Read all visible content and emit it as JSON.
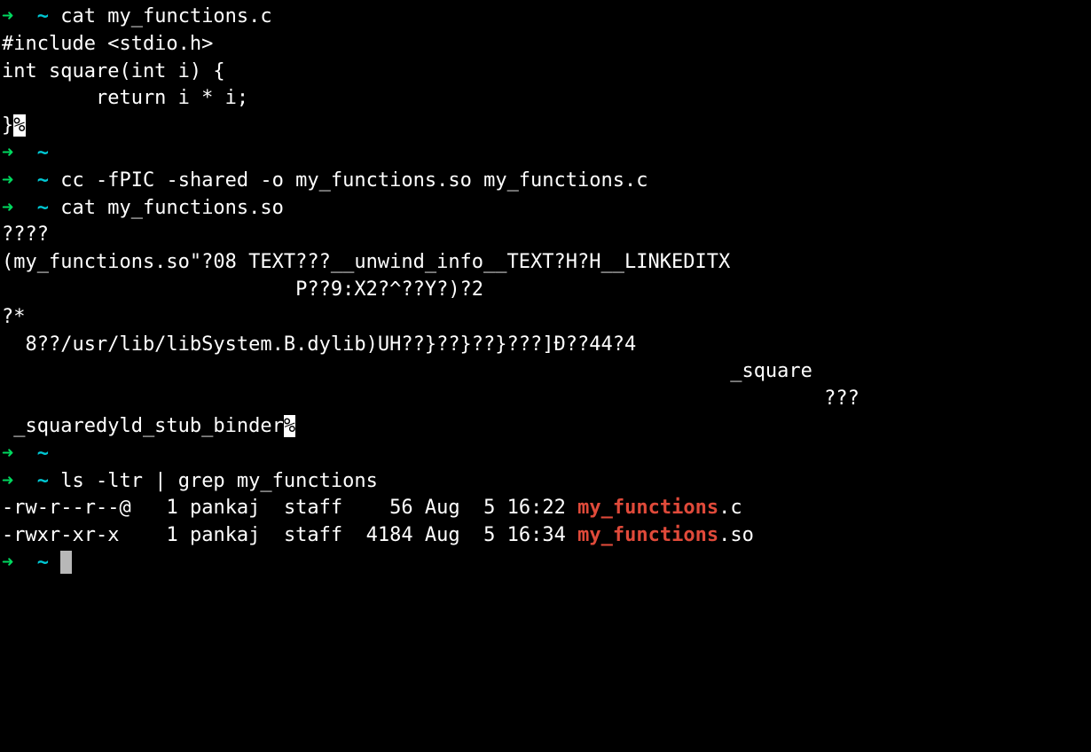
{
  "prompt": {
    "arrow": "➜",
    "tilde": "~"
  },
  "commands": {
    "cat_c": "cat my_functions.c",
    "empty": "",
    "cc": "cc -fPIC -shared -o my_functions.so my_functions.c",
    "cat_so": "cat my_functions.so",
    "ls_grep": "ls -ltr | grep my_functions"
  },
  "c_source": {
    "line1": "#include <stdio.h>",
    "line2": "",
    "line3": "int square(int i) {",
    "line4": "        return i * i;",
    "line5_a": "}",
    "line5_b": "%"
  },
  "so_binary": {
    "line1": "????",
    "line2": "(my_functions.so\"?08 TEXT???__unwind_info__TEXT?H?H__LINKEDITX",
    "line3": "                         P??9:X2?^??Y?)?2",
    "line4": "",
    "line5": "?*",
    "line6": "  8??/usr/lib/libSystem.B.dylib)UH??}??}??}???]Ð??44?4",
    "line7": "                                                              _square",
    "line8": "                                                                      ???",
    "line9_a": " _squaredyld_stub_binder",
    "line9_b": "%"
  },
  "ls_output": {
    "row1": {
      "perms": "-rw-r--r--@",
      "links": "1",
      "user": "pankaj",
      "group": "staff",
      "size": "56",
      "month": "Aug",
      "day": "5",
      "time": "16:22",
      "name_match": "my_functions",
      "name_ext": ".c"
    },
    "row2": {
      "perms": "-rwxr-xr-x ",
      "links": "1",
      "user": "pankaj",
      "group": "staff",
      "size": "4184",
      "month": "Aug",
      "day": "5",
      "time": "16:34",
      "name_match": "my_functions",
      "name_ext": ".so"
    }
  }
}
